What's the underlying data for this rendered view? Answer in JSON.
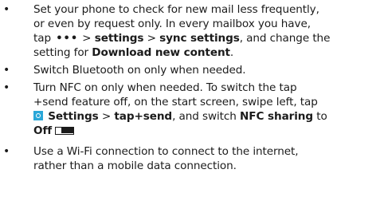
{
  "tips": [
    {
      "lines": [
        {
          "text": "Set your phone to check for new mail less frequently,"
        },
        {
          "text": "or even by request only. In every mailbox you have,"
        },
        {
          "pre": "tap",
          "icon": "more-dots-icon",
          "sep1": ">",
          "bold1": "settings",
          "sep2": ">",
          "bold2": "sync settings",
          "post": ", and change the"
        },
        {
          "pre": "setting for ",
          "bold": "Download new content",
          "post": "."
        }
      ]
    },
    {
      "lines": [
        {
          "text": "Switch Bluetooth on only when needed."
        }
      ]
    },
    {
      "lines": [
        {
          "text": "Turn NFC on only when needed. To switch the tap"
        },
        {
          "text": "+send feature off, on the start screen, swipe left, tap"
        },
        {
          "icon": "settings-gear-icon",
          "bold1": "Settings",
          "sep": " > ",
          "bold2": "tap+send",
          "mid": ", and switch ",
          "bold3": "NFC sharing",
          "post": " to"
        },
        {
          "bold": "Off",
          "icon": "toggle-off-icon"
        }
      ]
    },
    {
      "lines": [
        {
          "text": "Use a Wi-Fi connection to connect to the internet,"
        },
        {
          "text": "rather than a mobile data connection."
        }
      ]
    }
  ],
  "bullet_glyph": "•",
  "more_glyph": "•••"
}
